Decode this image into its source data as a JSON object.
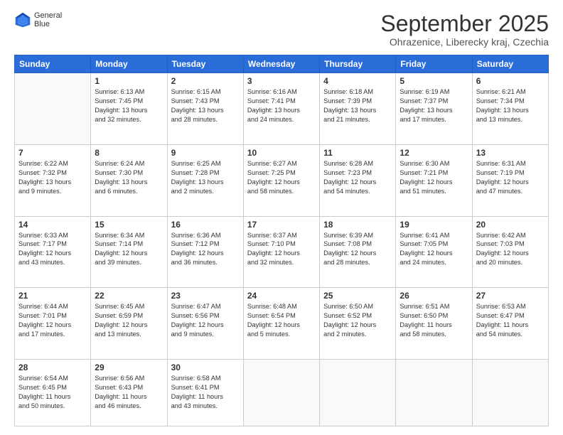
{
  "logo": {
    "general": "General",
    "blue": "Blue"
  },
  "title": "September 2025",
  "subtitle": "Ohrazenice, Liberecky kraj, Czechia",
  "headers": [
    "Sunday",
    "Monday",
    "Tuesday",
    "Wednesday",
    "Thursday",
    "Friday",
    "Saturday"
  ],
  "weeks": [
    [
      {
        "day": "",
        "info": ""
      },
      {
        "day": "1",
        "info": "Sunrise: 6:13 AM\nSunset: 7:45 PM\nDaylight: 13 hours\nand 32 minutes."
      },
      {
        "day": "2",
        "info": "Sunrise: 6:15 AM\nSunset: 7:43 PM\nDaylight: 13 hours\nand 28 minutes."
      },
      {
        "day": "3",
        "info": "Sunrise: 6:16 AM\nSunset: 7:41 PM\nDaylight: 13 hours\nand 24 minutes."
      },
      {
        "day": "4",
        "info": "Sunrise: 6:18 AM\nSunset: 7:39 PM\nDaylight: 13 hours\nand 21 minutes."
      },
      {
        "day": "5",
        "info": "Sunrise: 6:19 AM\nSunset: 7:37 PM\nDaylight: 13 hours\nand 17 minutes."
      },
      {
        "day": "6",
        "info": "Sunrise: 6:21 AM\nSunset: 7:34 PM\nDaylight: 13 hours\nand 13 minutes."
      }
    ],
    [
      {
        "day": "7",
        "info": "Sunrise: 6:22 AM\nSunset: 7:32 PM\nDaylight: 13 hours\nand 9 minutes."
      },
      {
        "day": "8",
        "info": "Sunrise: 6:24 AM\nSunset: 7:30 PM\nDaylight: 13 hours\nand 6 minutes."
      },
      {
        "day": "9",
        "info": "Sunrise: 6:25 AM\nSunset: 7:28 PM\nDaylight: 13 hours\nand 2 minutes."
      },
      {
        "day": "10",
        "info": "Sunrise: 6:27 AM\nSunset: 7:25 PM\nDaylight: 12 hours\nand 58 minutes."
      },
      {
        "day": "11",
        "info": "Sunrise: 6:28 AM\nSunset: 7:23 PM\nDaylight: 12 hours\nand 54 minutes."
      },
      {
        "day": "12",
        "info": "Sunrise: 6:30 AM\nSunset: 7:21 PM\nDaylight: 12 hours\nand 51 minutes."
      },
      {
        "day": "13",
        "info": "Sunrise: 6:31 AM\nSunset: 7:19 PM\nDaylight: 12 hours\nand 47 minutes."
      }
    ],
    [
      {
        "day": "14",
        "info": "Sunrise: 6:33 AM\nSunset: 7:17 PM\nDaylight: 12 hours\nand 43 minutes."
      },
      {
        "day": "15",
        "info": "Sunrise: 6:34 AM\nSunset: 7:14 PM\nDaylight: 12 hours\nand 39 minutes."
      },
      {
        "day": "16",
        "info": "Sunrise: 6:36 AM\nSunset: 7:12 PM\nDaylight: 12 hours\nand 36 minutes."
      },
      {
        "day": "17",
        "info": "Sunrise: 6:37 AM\nSunset: 7:10 PM\nDaylight: 12 hours\nand 32 minutes."
      },
      {
        "day": "18",
        "info": "Sunrise: 6:39 AM\nSunset: 7:08 PM\nDaylight: 12 hours\nand 28 minutes."
      },
      {
        "day": "19",
        "info": "Sunrise: 6:41 AM\nSunset: 7:05 PM\nDaylight: 12 hours\nand 24 minutes."
      },
      {
        "day": "20",
        "info": "Sunrise: 6:42 AM\nSunset: 7:03 PM\nDaylight: 12 hours\nand 20 minutes."
      }
    ],
    [
      {
        "day": "21",
        "info": "Sunrise: 6:44 AM\nSunset: 7:01 PM\nDaylight: 12 hours\nand 17 minutes."
      },
      {
        "day": "22",
        "info": "Sunrise: 6:45 AM\nSunset: 6:59 PM\nDaylight: 12 hours\nand 13 minutes."
      },
      {
        "day": "23",
        "info": "Sunrise: 6:47 AM\nSunset: 6:56 PM\nDaylight: 12 hours\nand 9 minutes."
      },
      {
        "day": "24",
        "info": "Sunrise: 6:48 AM\nSunset: 6:54 PM\nDaylight: 12 hours\nand 5 minutes."
      },
      {
        "day": "25",
        "info": "Sunrise: 6:50 AM\nSunset: 6:52 PM\nDaylight: 12 hours\nand 2 minutes."
      },
      {
        "day": "26",
        "info": "Sunrise: 6:51 AM\nSunset: 6:50 PM\nDaylight: 11 hours\nand 58 minutes."
      },
      {
        "day": "27",
        "info": "Sunrise: 6:53 AM\nSunset: 6:47 PM\nDaylight: 11 hours\nand 54 minutes."
      }
    ],
    [
      {
        "day": "28",
        "info": "Sunrise: 6:54 AM\nSunset: 6:45 PM\nDaylight: 11 hours\nand 50 minutes."
      },
      {
        "day": "29",
        "info": "Sunrise: 6:56 AM\nSunset: 6:43 PM\nDaylight: 11 hours\nand 46 minutes."
      },
      {
        "day": "30",
        "info": "Sunrise: 6:58 AM\nSunset: 6:41 PM\nDaylight: 11 hours\nand 43 minutes."
      },
      {
        "day": "",
        "info": ""
      },
      {
        "day": "",
        "info": ""
      },
      {
        "day": "",
        "info": ""
      },
      {
        "day": "",
        "info": ""
      }
    ]
  ]
}
